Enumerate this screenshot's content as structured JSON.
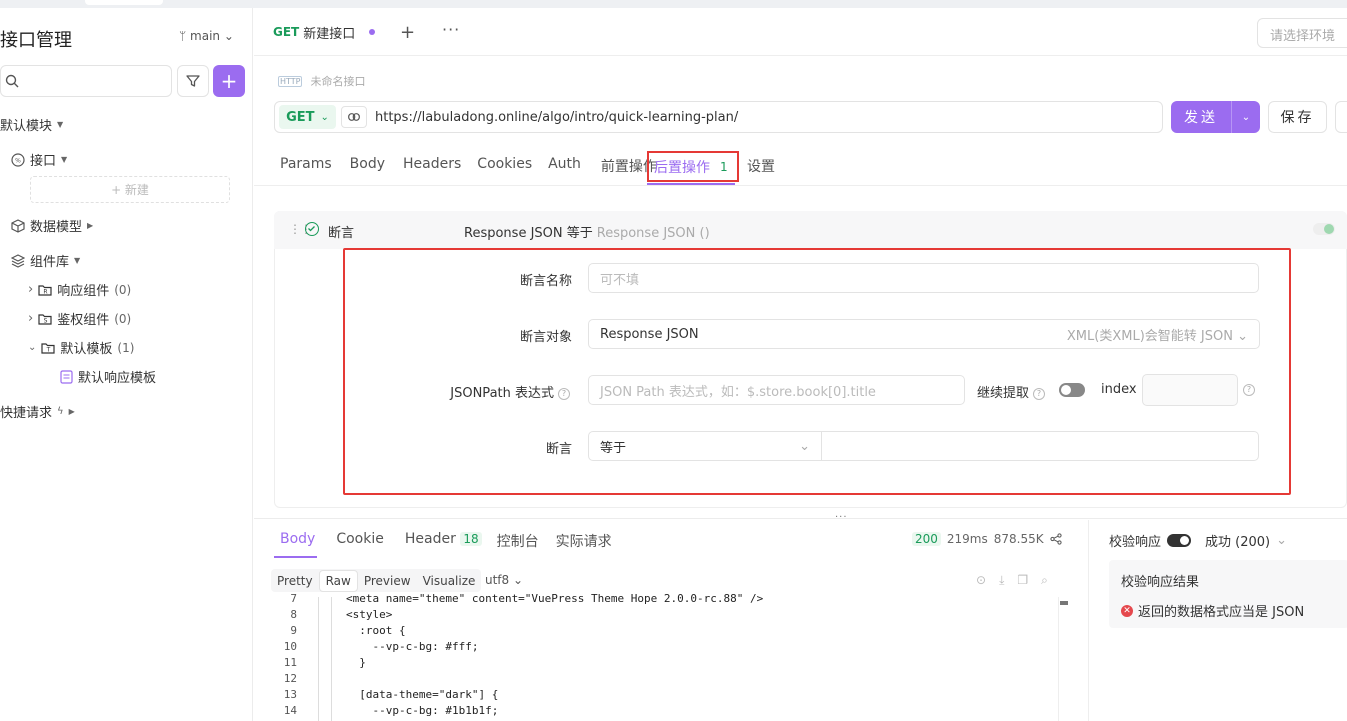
{
  "sidebar": {
    "title": "接口管理",
    "branch": "main",
    "tree": {
      "default_module": "默认模块",
      "interfaces": "接口",
      "new_label": "+ 新建",
      "data_models": "数据模型",
      "component_lib": "组件库",
      "response_components": "响应组件",
      "response_components_count": "(0)",
      "auth_components": "鉴权组件",
      "auth_components_count": "(0)",
      "default_templates": "默认模板",
      "default_templates_count": "(1)",
      "default_response_template": "默认响应模板",
      "quick_requests": "快捷请求"
    }
  },
  "tabbar": {
    "tab_method": "GET",
    "tab_title": "新建接口",
    "env_placeholder": "请选择环境"
  },
  "request": {
    "name_placeholder": "未命名接口",
    "method": "GET",
    "url": "https://labuladong.online/algo/intro/quick-learning-plan/",
    "send_label": "发送",
    "save_label": "保存"
  },
  "subtabs": {
    "items": [
      "Params",
      "Body",
      "Headers",
      "Cookies",
      "Auth",
      "前置操作"
    ],
    "active_label": "后置操作",
    "active_badge": "1",
    "settings": "设置"
  },
  "assertion": {
    "title": "断言",
    "summary": "Response JSON 等于",
    "summary_muted": "Response JSON ()",
    "name_label": "断言名称",
    "name_placeholder": "可不填",
    "target_label": "断言对象",
    "target_value": "Response JSON",
    "target_hint": "XML(类XML)会智能转 JSON",
    "jsonpath_label": "JSONPath 表达式",
    "jsonpath_placeholder": "JSON Path 表达式，如：$.store.book[0].title",
    "continue_label": "继续提取",
    "index_label": "index",
    "assert_label": "断言",
    "assert_op": "等于"
  },
  "response": {
    "tabs": {
      "body": "Body",
      "cookie": "Cookie",
      "header": "Header",
      "header_count": "18",
      "console": "控制台",
      "actual": "实际请求"
    },
    "status_code": "200",
    "time": "219ms",
    "size": "878.55K",
    "views": [
      "Pretty",
      "Raw",
      "Preview",
      "Visualize"
    ],
    "active_view": "Raw",
    "encoding": "utf8",
    "code_lines": [
      {
        "n": "7",
        "t": "<meta name=\"theme\" content=\"VuePress Theme Hope 2.0.0-rc.88\" />"
      },
      {
        "n": "8",
        "t": "<style>"
      },
      {
        "n": "9",
        "t": "  :root {"
      },
      {
        "n": "10",
        "t": "    --vp-c-bg: #fff;"
      },
      {
        "n": "11",
        "t": "  }"
      },
      {
        "n": "12",
        "t": ""
      },
      {
        "n": "13",
        "t": "  [data-theme=\"dark\"] {"
      },
      {
        "n": "14",
        "t": "    --vp-c-bg: #1b1b1f;"
      }
    ]
  },
  "validation": {
    "label": "校验响应",
    "result_status": "成功 (200)",
    "result_title": "校验响应结果",
    "error_text": "返回的数据格式应当是 JSON"
  },
  "colors": {
    "accent": "#9b6cf0",
    "get_green": "#1a9b5a",
    "highlight_red": "#e53935"
  }
}
